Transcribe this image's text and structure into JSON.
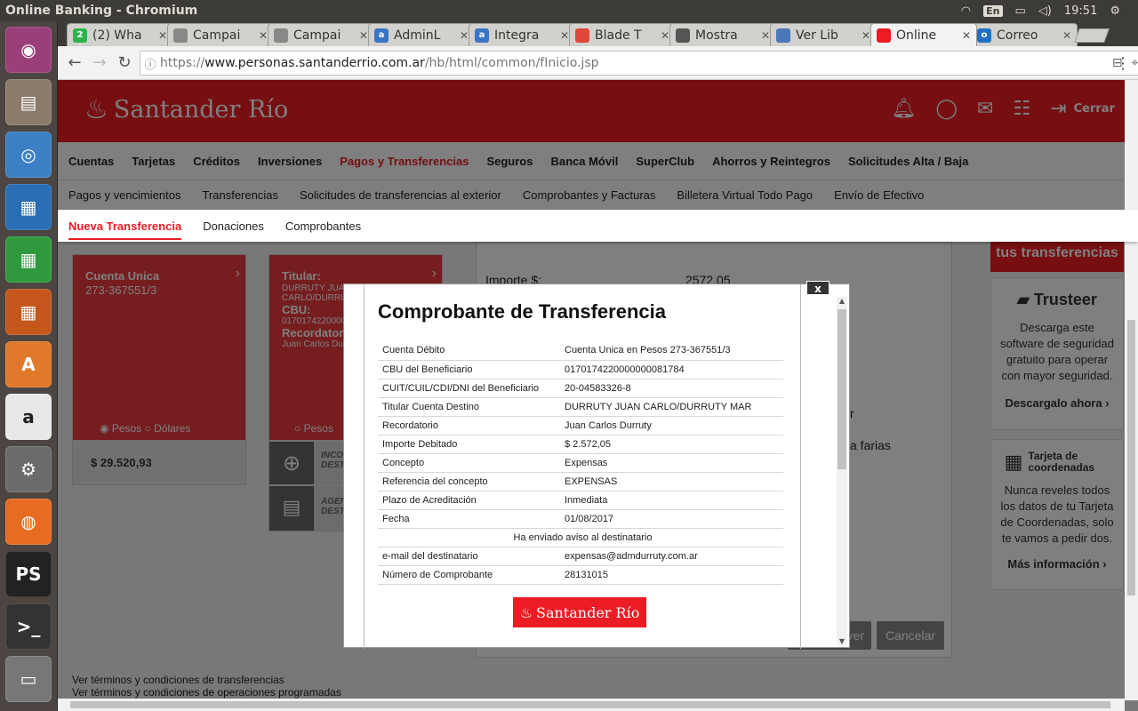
{
  "os": {
    "window_title": "Online Banking - Chromium",
    "keyboard_layout": "En",
    "clock": "19:51"
  },
  "launcher": [
    {
      "name": "ubuntu-dash-icon",
      "glyph": "◉",
      "color": "#9b3f7a"
    },
    {
      "name": "files-icon",
      "glyph": "▤",
      "color": "#8c7b6b"
    },
    {
      "name": "chromium-icon",
      "glyph": "◎",
      "color": "#3b7fc4"
    },
    {
      "name": "writer-icon",
      "glyph": "▦",
      "color": "#2a6eb5"
    },
    {
      "name": "calc-icon",
      "glyph": "▦",
      "color": "#2f9a3d"
    },
    {
      "name": "impress-icon",
      "glyph": "▦",
      "color": "#c5561c"
    },
    {
      "name": "software-center-icon",
      "glyph": "A",
      "color": "#e07a2a"
    },
    {
      "name": "amazon-icon",
      "glyph": "a",
      "color": "#e8e8e8"
    },
    {
      "name": "settings-icon",
      "glyph": "⚙",
      "color": "#6b6b6b"
    },
    {
      "name": "firefox-icon",
      "glyph": "◍",
      "color": "#e76b21"
    },
    {
      "name": "phpstorm-icon",
      "glyph": "PS",
      "color": "#222"
    },
    {
      "name": "terminal-icon",
      "glyph": ">_",
      "color": "#333"
    },
    {
      "name": "drive-icon",
      "glyph": "▭",
      "color": "#777"
    }
  ],
  "tabs": [
    {
      "label": "(2) Wha",
      "fav": "2",
      "favcolor": "#2fb24c"
    },
    {
      "label": "Campai",
      "fav": "",
      "favcolor": "#888"
    },
    {
      "label": "Campai",
      "fav": "",
      "favcolor": "#888"
    },
    {
      "label": "AdminL",
      "fav": "a",
      "favcolor": "#3a74c5"
    },
    {
      "label": "Integra",
      "fav": "a",
      "favcolor": "#3a74c5"
    },
    {
      "label": "Blade T",
      "fav": "",
      "favcolor": "#e0473a"
    },
    {
      "label": "Mostra",
      "fav": "",
      "favcolor": "#555"
    },
    {
      "label": "Ver Lib",
      "fav": "",
      "favcolor": "#4a78b8"
    },
    {
      "label": "Online",
      "fav": "",
      "favcolor": "#ec1c24"
    },
    {
      "label": "Correo",
      "fav": "o",
      "favcolor": "#1f6fc4"
    }
  ],
  "address": {
    "scheme": "https://",
    "host": "www.personas.santanderrio.com.ar",
    "path": "/hb/html/common/fInicio.jsp"
  },
  "site": {
    "brand": "Santander Río",
    "logout": "Cerrar",
    "main_nav": [
      "Cuentas",
      "Tarjetas",
      "Créditos",
      "Inversiones",
      "Pagos y Transferencias",
      "Seguros",
      "Banca Móvil",
      "SuperClub",
      "Ahorros y Reintegros",
      "Solicitudes Alta / Baja"
    ],
    "sub_nav": [
      "Pagos y vencimientos",
      "Transferencias",
      "Solicitudes de transferencias al exterior",
      "Comprobantes y Facturas",
      "Billetera Virtual Todo Pago",
      "Envío de Efectivo"
    ],
    "sub_sub_nav": [
      "Nueva Transferencia",
      "Donaciones",
      "Comprobantes"
    ]
  },
  "background": {
    "account_card": {
      "title": "Cuenta Unica",
      "number": "273-367551/3",
      "radio_pesos": "Pesos",
      "radio_dolares": "Dólares",
      "balance": "$ 29.520,93"
    },
    "dest_card": {
      "titular_label": "Titular:",
      "titular": "DURRUTY JUA",
      "titular2": "CARLO/DURRU",
      "cbu_label": "CBU:",
      "cbu": "0170174220000",
      "recordatorio_label": "Recordator",
      "recordatorio": "Juan Carlos Du",
      "radio_pesos": "Pesos",
      "action1": "INCO",
      "action1b": "DEST",
      "action2": "AGEN",
      "action2b": "DEST"
    },
    "summary": {
      "importe_label": "Importe $:",
      "importe": "2572.05",
      "frag1": "r",
      "frag2": "a farias"
    },
    "buttons": {
      "volver": "ver",
      "cancelar": "Cancelar"
    },
    "terms1": "Ver términos y condiciones de transferencias",
    "terms2": "Ver términos y condiciones de operaciones programadas",
    "ads": {
      "top_text": "tus transferencias",
      "trusteer_brand": "Trusteer",
      "trusteer_text": "Descarga este software de seguridad gratuito para operar con mayor seguridad.",
      "trusteer_link": "Descargalo ahora ›",
      "card_title": "Tarjeta de coordenadas",
      "card_text": "Nunca reveles todos los datos de tu Tarjeta de Coordenadas, solo te vamos a pedir dos.",
      "card_link": "Más información ›"
    }
  },
  "modal": {
    "close_label": "x",
    "title": "Comprobante de Transferencia",
    "rows": [
      {
        "k": "Cuenta Débito",
        "v": "Cuenta Unica en Pesos 273-367551/3"
      },
      {
        "k": "CBU del Beneficiario",
        "v": "0170174220000000081784"
      },
      {
        "k": "CUIT/CUIL/CDI/DNI del Beneficiario",
        "v": "20-04583326-8"
      },
      {
        "k": "Titular Cuenta Destino",
        "v": "DURRUTY JUAN CARLO/DURRUTY MAR"
      },
      {
        "k": "Recordatorio",
        "v": "Juan Carlos Durruty"
      },
      {
        "k": "Importe Debitado",
        "v": "$ 2.572,05"
      },
      {
        "k": "Concepto",
        "v": "Expensas"
      },
      {
        "k": "Referencia del concepto",
        "v": "EXPENSAS"
      },
      {
        "k": "Plazo de Acreditación",
        "v": "Inmediata"
      },
      {
        "k": "Fecha",
        "v": "01/08/2017"
      }
    ],
    "notice": "Ha enviado aviso al destinatario",
    "rows2": [
      {
        "k": "e-mail del destinatario",
        "v": "expensas@admdurruty.com.ar"
      },
      {
        "k": "Número de Comprobante",
        "v": "28131015"
      }
    ],
    "footer_brand": "Santander Río"
  }
}
